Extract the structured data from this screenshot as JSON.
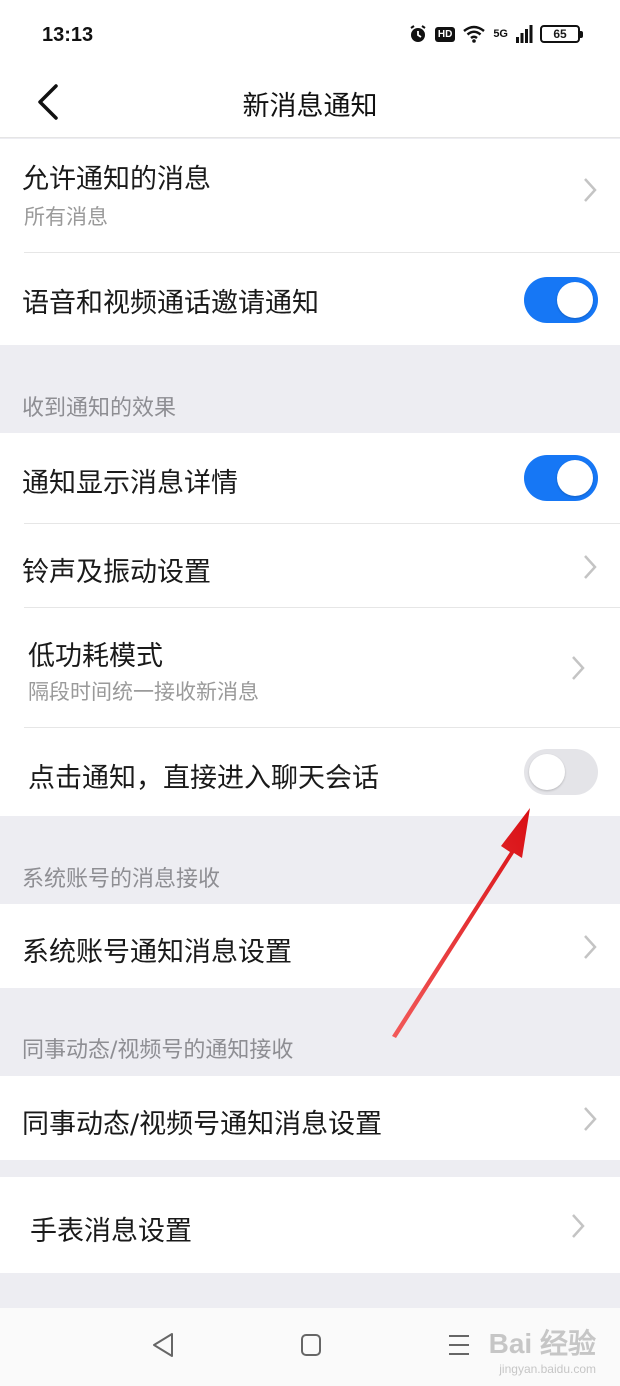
{
  "status_bar": {
    "time": "13:13",
    "network": "5G",
    "hd_badge": "HD",
    "battery": "65"
  },
  "header": {
    "title": "新消息通知"
  },
  "settings": {
    "allowed_messages": {
      "label": "允许通知的消息",
      "value": "所有消息"
    },
    "call_invite": {
      "label": "语音和视频通话邀请通知",
      "enabled": true
    }
  },
  "sections": {
    "effects": "收到通知的效果",
    "system_accounts": "系统账号的消息接收",
    "colleague_moments": "同事动态/视频号的通知接收"
  },
  "effects": {
    "show_details": {
      "label": "通知显示消息详情",
      "enabled": true
    },
    "ringtone": {
      "label": "铃声及振动设置"
    },
    "low_power": {
      "label": "低功耗模式",
      "sub": "隔段时间统一接收新消息"
    },
    "tap_to_chat": {
      "label": "点击通知，直接进入聊天会话",
      "enabled": false
    }
  },
  "system_accounts": {
    "settings": {
      "label": "系统账号通知消息设置"
    }
  },
  "colleague_moments": {
    "settings": {
      "label": "同事动态/视频号通知消息设置"
    }
  },
  "watch": {
    "settings": {
      "label": "手表消息设置"
    }
  },
  "watermark": {
    "main": "Bai 经验",
    "sub": "jingyan.baidu.com"
  },
  "colors": {
    "accent": "#1677f5",
    "annotation_arrow": "#e8161b"
  },
  "icons": {
    "back": "chevron-left-icon",
    "chevron": "chevron-right-icon",
    "nav_back": "triangle-back-icon",
    "nav_home": "square-home-icon",
    "nav_menu": "menu-lines-icon"
  }
}
